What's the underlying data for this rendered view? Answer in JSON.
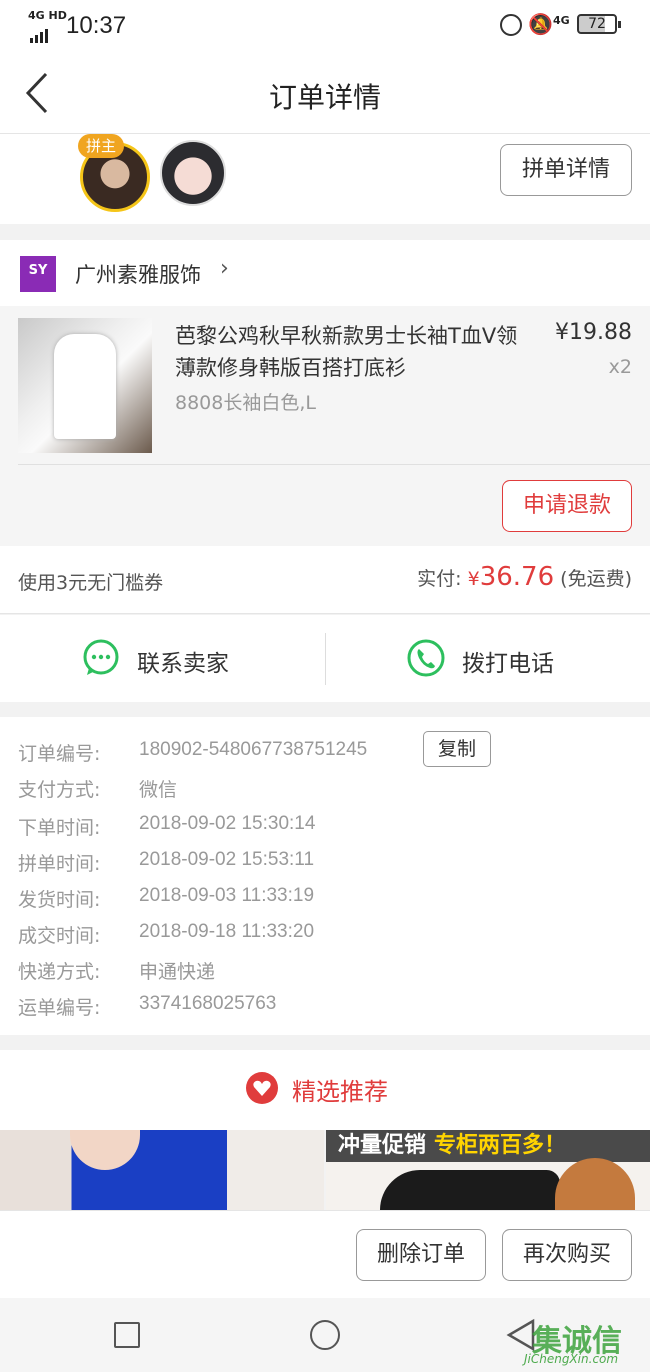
{
  "status_bar": {
    "network": "4G HD",
    "time": "10:37",
    "network_right": "4G",
    "battery": "72"
  },
  "header": {
    "title": "订单详情"
  },
  "group_buy": {
    "leader_badge": "拼主",
    "details_button": "拼单详情"
  },
  "shop": {
    "logo_text": "SY",
    "name": "广州素雅服饰",
    "chevron": "›"
  },
  "product": {
    "title": "芭黎公鸡秋早秋新款男士长袖T血V领薄款修身韩版百搭打底衫",
    "price": "¥19.88",
    "quantity": "x2",
    "sku": "8808长袖白色,L",
    "refund_button": "申请退款"
  },
  "payment": {
    "coupon": "使用3元无门槛券",
    "paid_label": "实付:",
    "currency": "¥",
    "amount": "36.76",
    "shipping_note": "(免运费)"
  },
  "contact": {
    "seller_label": "联系卖家",
    "phone_label": "拨打电话"
  },
  "order_details": {
    "copy_button": "复制",
    "rows": [
      {
        "label": "订单编号:",
        "value": "180902-548067738751245"
      },
      {
        "label": "支付方式:",
        "value": "微信"
      },
      {
        "label": "下单时间:",
        "value": "2018-09-02 15:30:14"
      },
      {
        "label": "拼单时间:",
        "value": "2018-09-02 15:53:11"
      },
      {
        "label": "发货时间:",
        "value": "2018-09-03 11:33:19"
      },
      {
        "label": "成交时间:",
        "value": "2018-09-18 11:33:20"
      },
      {
        "label": "快递方式:",
        "value": "申通快递"
      },
      {
        "label": "运单编号:",
        "value": "3374168025763"
      }
    ]
  },
  "recommend": {
    "title": "精选推荐",
    "banner_white": "冲量促销",
    "banner_yellow": "专柜两百多！"
  },
  "actions": {
    "delete_button": "删除订单",
    "rebuy_button": "再次购买"
  },
  "watermark": {
    "main": "集诚信",
    "sub": "JiChengXin.com"
  },
  "colors": {
    "accent_red": "#e03c3c",
    "wechat_green": "#2dbf5e",
    "badge_orange": "#f0a520"
  }
}
